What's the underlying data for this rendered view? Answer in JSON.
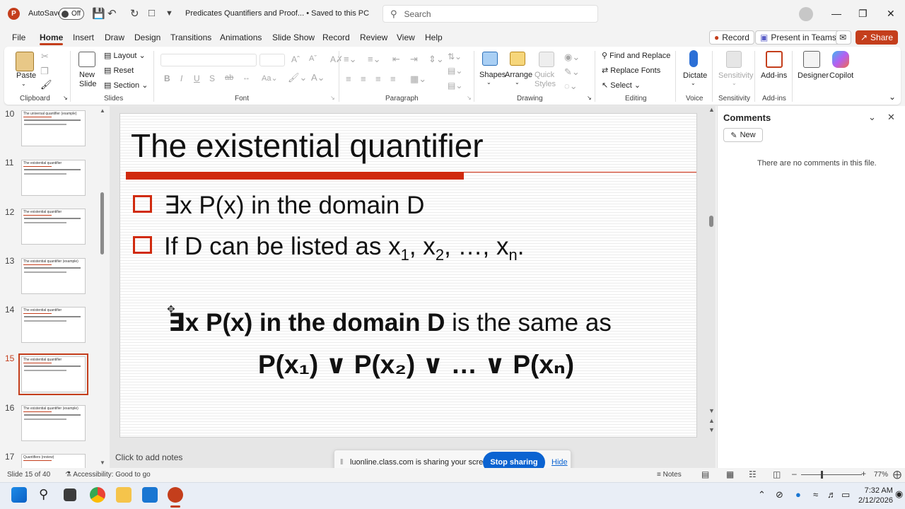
{
  "titlebar": {
    "app_logo": "P",
    "autosave_label": "AutoSave",
    "autosave_state": "Off",
    "doc_title": "Predicates Quantifiers and Proof...  •  Saved to this PC",
    "search_placeholder": "Search"
  },
  "menu": {
    "tabs": [
      "File",
      "Home",
      "Insert",
      "Draw",
      "Design",
      "Transitions",
      "Animations",
      "Slide Show",
      "Record",
      "Review",
      "View",
      "Help"
    ],
    "active_tab": "Home",
    "record_label": "Record",
    "present_label": "Present in Teams",
    "share_label": "Share"
  },
  "ribbon": {
    "clipboard": {
      "paste": "Paste",
      "label": "Clipboard"
    },
    "slides": {
      "new_slide": "New\nSlide",
      "layout": "Layout",
      "reset": "Reset",
      "section": "Section",
      "label": "Slides"
    },
    "font": {
      "label": "Font",
      "bold": "B",
      "italic": "I",
      "underline": "U",
      "strike": "S",
      "shadow": "ab"
    },
    "paragraph": {
      "label": "Paragraph"
    },
    "drawing": {
      "shapes": "Shapes",
      "arrange": "Arrange",
      "quick_styles": "Quick\nStyles",
      "label": "Drawing"
    },
    "editing": {
      "find_replace": "Find and Replace",
      "replace_fonts": "Replace Fonts",
      "select": "Select",
      "label": "Editing"
    },
    "voice": {
      "dictate": "Dictate",
      "label": "Voice"
    },
    "sensitivity": {
      "btn": "Sensitivity",
      "label": "Sensitivity"
    },
    "addins": {
      "btn": "Add-ins",
      "label": "Add-ins"
    },
    "designer": "Designer",
    "copilot": "Copilot"
  },
  "thumbnails": [
    {
      "num": "10",
      "title": "The universal quantifier (example)"
    },
    {
      "num": "11",
      "title": "The existential quantifier"
    },
    {
      "num": "12",
      "title": "The existential quantifier"
    },
    {
      "num": "13",
      "title": "The existential quantifier (example)"
    },
    {
      "num": "14",
      "title": "The existential quantifier"
    },
    {
      "num": "15",
      "title": "The existential quantifier"
    },
    {
      "num": "16",
      "title": "The existential quantifier (example)"
    },
    {
      "num": "17",
      "title": "Quantifiers (review)"
    }
  ],
  "selected_thumbnail": "15",
  "slide": {
    "title": "The existential quantifier",
    "bullet1": "∃x P(x) in the domain D",
    "bullet2_prefix": "If D can be listed as x",
    "statement_bold": "∃x P(x) in the domain D",
    "statement_rest": " is the same as",
    "disjunction": "P(x₁) ∨ P(x₂) ∨ … ∨ P(xₙ)"
  },
  "notes_placeholder": "Click to add notes",
  "comments": {
    "title": "Comments",
    "new_label": "New",
    "empty_text": "There are no comments in this file."
  },
  "share_toast": {
    "message": "luonline.class.com is sharing your screen.",
    "stop_label": "Stop sharing",
    "hide_label": "Hide"
  },
  "statusbar": {
    "slide_info": "Slide 15 of 40",
    "accessibility": "Accessibility: Good to go",
    "notes_label": "Notes",
    "zoom": "77%"
  },
  "taskbar": {
    "time": "7:32 AM",
    "date": "2/12/2026"
  },
  "colors": {
    "accent": "#c43e1c",
    "slide_red": "#d02a0e",
    "share_blue": "#0b63d1"
  }
}
